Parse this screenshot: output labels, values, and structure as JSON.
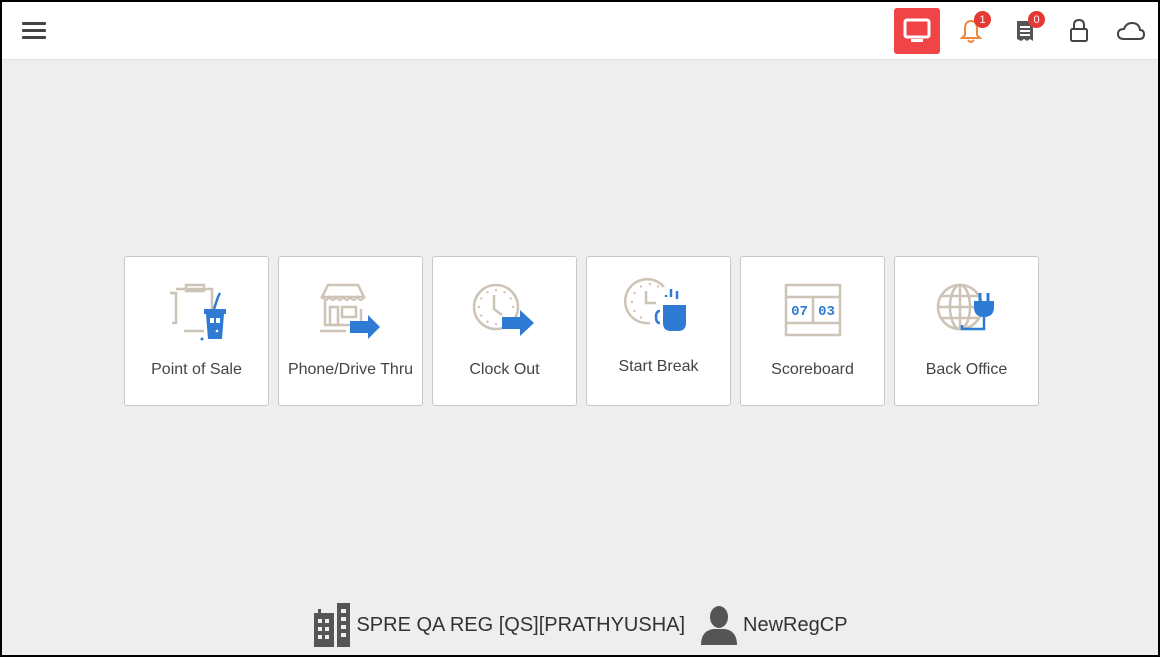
{
  "header": {
    "menu_icon": "hamburger-menu-icon",
    "icons": [
      {
        "name": "display-icon",
        "active": true
      },
      {
        "name": "bell-icon",
        "badge": "1"
      },
      {
        "name": "receipt-icon",
        "badge": "0"
      },
      {
        "name": "lock-icon"
      },
      {
        "name": "cloud-icon"
      }
    ]
  },
  "tiles": [
    {
      "label": "Point of Sale",
      "icon": "point-of-sale-icon"
    },
    {
      "label": "Phone/Drive Thru",
      "icon": "drive-thru-icon"
    },
    {
      "label": "Clock Out",
      "icon": "clock-out-icon"
    },
    {
      "label": "Start Break",
      "icon": "start-break-icon"
    },
    {
      "label": "Scoreboard",
      "icon": "scoreboard-icon",
      "digits": [
        "07",
        "03"
      ]
    },
    {
      "label": "Back Office",
      "icon": "back-office-icon"
    }
  ],
  "footer": {
    "store": "SPRE QA REG [QS][PRATHYUSHA]",
    "user": "NewRegCP"
  },
  "colors": {
    "accent_blue": "#2f7bd3",
    "icon_beige": "#cdc3b6",
    "alert_red": "#f04447",
    "bell_orange": "#f0883a"
  }
}
